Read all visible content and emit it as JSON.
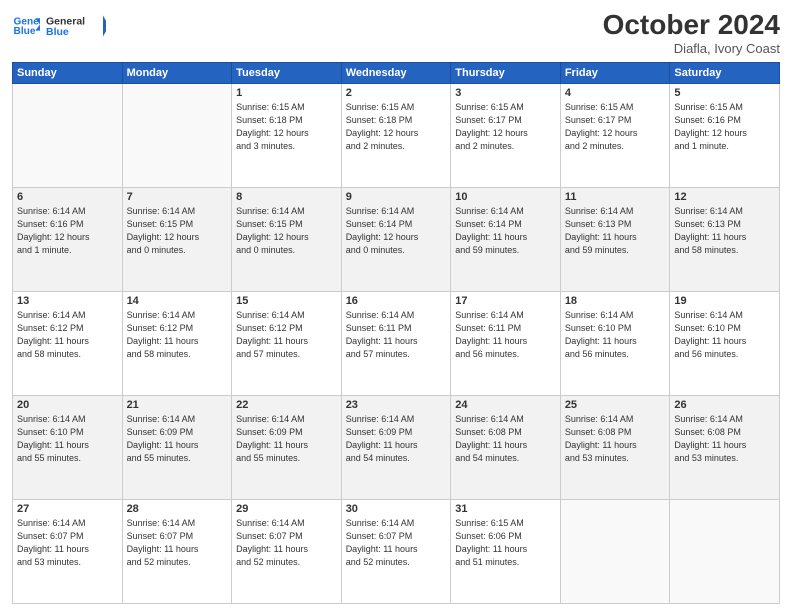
{
  "header": {
    "logo_line1": "General",
    "logo_line2": "Blue",
    "month_title": "October 2024",
    "subtitle": "Diafla, Ivory Coast"
  },
  "days_of_week": [
    "Sunday",
    "Monday",
    "Tuesday",
    "Wednesday",
    "Thursday",
    "Friday",
    "Saturday"
  ],
  "weeks": [
    [
      {
        "day": "",
        "info": ""
      },
      {
        "day": "",
        "info": ""
      },
      {
        "day": "1",
        "info": "Sunrise: 6:15 AM\nSunset: 6:18 PM\nDaylight: 12 hours\nand 3 minutes."
      },
      {
        "day": "2",
        "info": "Sunrise: 6:15 AM\nSunset: 6:18 PM\nDaylight: 12 hours\nand 2 minutes."
      },
      {
        "day": "3",
        "info": "Sunrise: 6:15 AM\nSunset: 6:17 PM\nDaylight: 12 hours\nand 2 minutes."
      },
      {
        "day": "4",
        "info": "Sunrise: 6:15 AM\nSunset: 6:17 PM\nDaylight: 12 hours\nand 2 minutes."
      },
      {
        "day": "5",
        "info": "Sunrise: 6:15 AM\nSunset: 6:16 PM\nDaylight: 12 hours\nand 1 minute."
      }
    ],
    [
      {
        "day": "6",
        "info": "Sunrise: 6:14 AM\nSunset: 6:16 PM\nDaylight: 12 hours\nand 1 minute."
      },
      {
        "day": "7",
        "info": "Sunrise: 6:14 AM\nSunset: 6:15 PM\nDaylight: 12 hours\nand 0 minutes."
      },
      {
        "day": "8",
        "info": "Sunrise: 6:14 AM\nSunset: 6:15 PM\nDaylight: 12 hours\nand 0 minutes."
      },
      {
        "day": "9",
        "info": "Sunrise: 6:14 AM\nSunset: 6:14 PM\nDaylight: 12 hours\nand 0 minutes."
      },
      {
        "day": "10",
        "info": "Sunrise: 6:14 AM\nSunset: 6:14 PM\nDaylight: 11 hours\nand 59 minutes."
      },
      {
        "day": "11",
        "info": "Sunrise: 6:14 AM\nSunset: 6:13 PM\nDaylight: 11 hours\nand 59 minutes."
      },
      {
        "day": "12",
        "info": "Sunrise: 6:14 AM\nSunset: 6:13 PM\nDaylight: 11 hours\nand 58 minutes."
      }
    ],
    [
      {
        "day": "13",
        "info": "Sunrise: 6:14 AM\nSunset: 6:12 PM\nDaylight: 11 hours\nand 58 minutes."
      },
      {
        "day": "14",
        "info": "Sunrise: 6:14 AM\nSunset: 6:12 PM\nDaylight: 11 hours\nand 58 minutes."
      },
      {
        "day": "15",
        "info": "Sunrise: 6:14 AM\nSunset: 6:12 PM\nDaylight: 11 hours\nand 57 minutes."
      },
      {
        "day": "16",
        "info": "Sunrise: 6:14 AM\nSunset: 6:11 PM\nDaylight: 11 hours\nand 57 minutes."
      },
      {
        "day": "17",
        "info": "Sunrise: 6:14 AM\nSunset: 6:11 PM\nDaylight: 11 hours\nand 56 minutes."
      },
      {
        "day": "18",
        "info": "Sunrise: 6:14 AM\nSunset: 6:10 PM\nDaylight: 11 hours\nand 56 minutes."
      },
      {
        "day": "19",
        "info": "Sunrise: 6:14 AM\nSunset: 6:10 PM\nDaylight: 11 hours\nand 56 minutes."
      }
    ],
    [
      {
        "day": "20",
        "info": "Sunrise: 6:14 AM\nSunset: 6:10 PM\nDaylight: 11 hours\nand 55 minutes."
      },
      {
        "day": "21",
        "info": "Sunrise: 6:14 AM\nSunset: 6:09 PM\nDaylight: 11 hours\nand 55 minutes."
      },
      {
        "day": "22",
        "info": "Sunrise: 6:14 AM\nSunset: 6:09 PM\nDaylight: 11 hours\nand 55 minutes."
      },
      {
        "day": "23",
        "info": "Sunrise: 6:14 AM\nSunset: 6:09 PM\nDaylight: 11 hours\nand 54 minutes."
      },
      {
        "day": "24",
        "info": "Sunrise: 6:14 AM\nSunset: 6:08 PM\nDaylight: 11 hours\nand 54 minutes."
      },
      {
        "day": "25",
        "info": "Sunrise: 6:14 AM\nSunset: 6:08 PM\nDaylight: 11 hours\nand 53 minutes."
      },
      {
        "day": "26",
        "info": "Sunrise: 6:14 AM\nSunset: 6:08 PM\nDaylight: 11 hours\nand 53 minutes."
      }
    ],
    [
      {
        "day": "27",
        "info": "Sunrise: 6:14 AM\nSunset: 6:07 PM\nDaylight: 11 hours\nand 53 minutes."
      },
      {
        "day": "28",
        "info": "Sunrise: 6:14 AM\nSunset: 6:07 PM\nDaylight: 11 hours\nand 52 minutes."
      },
      {
        "day": "29",
        "info": "Sunrise: 6:14 AM\nSunset: 6:07 PM\nDaylight: 11 hours\nand 52 minutes."
      },
      {
        "day": "30",
        "info": "Sunrise: 6:14 AM\nSunset: 6:07 PM\nDaylight: 11 hours\nand 52 minutes."
      },
      {
        "day": "31",
        "info": "Sunrise: 6:15 AM\nSunset: 6:06 PM\nDaylight: 11 hours\nand 51 minutes."
      },
      {
        "day": "",
        "info": ""
      },
      {
        "day": "",
        "info": ""
      }
    ]
  ]
}
